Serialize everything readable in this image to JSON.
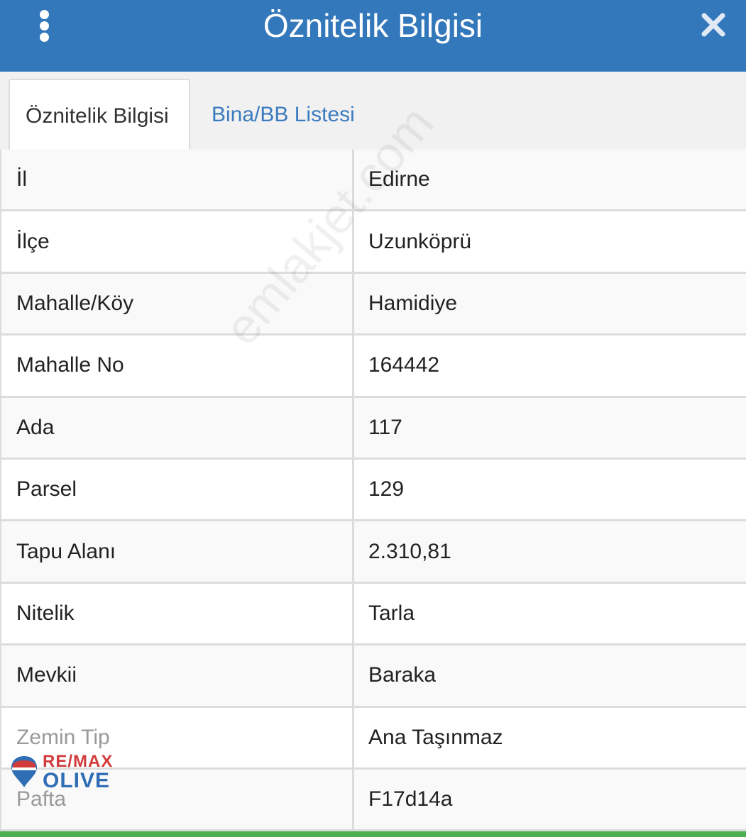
{
  "header": {
    "title": "Öznitelik Bilgisi",
    "menu_icon": "vertical-dots-icon",
    "close_icon": "close-icon"
  },
  "tabs": [
    {
      "label": "Öznitelik Bilgisi",
      "active": true
    },
    {
      "label": "Bina/BB Listesi",
      "active": false
    }
  ],
  "rows": [
    {
      "key": "İl",
      "value": "Edirne"
    },
    {
      "key": "İlçe",
      "value": "Uzunköprü"
    },
    {
      "key": "Mahalle/Köy",
      "value": "Hamidiye"
    },
    {
      "key": "Mahalle No",
      "value": "164442"
    },
    {
      "key": "Ada",
      "value": "117"
    },
    {
      "key": "Parsel",
      "value": "129"
    },
    {
      "key": "Tapu Alanı",
      "value": "2.310,81"
    },
    {
      "key": "Nitelik",
      "value": "Tarla"
    },
    {
      "key": "Mevkii",
      "value": "Baraka"
    },
    {
      "key": "Zemin Tip",
      "value": "Ana Taşınmaz"
    },
    {
      "key": "Pafta",
      "value": "F17d14a"
    }
  ],
  "watermark": "emlakjet.com",
  "logo": {
    "line1": "RE/MAX",
    "line2": "OLIVE"
  },
  "colors": {
    "header": "#3478bc",
    "tab_link": "#3a7bbf",
    "bottom_bar": "#4caf50"
  }
}
